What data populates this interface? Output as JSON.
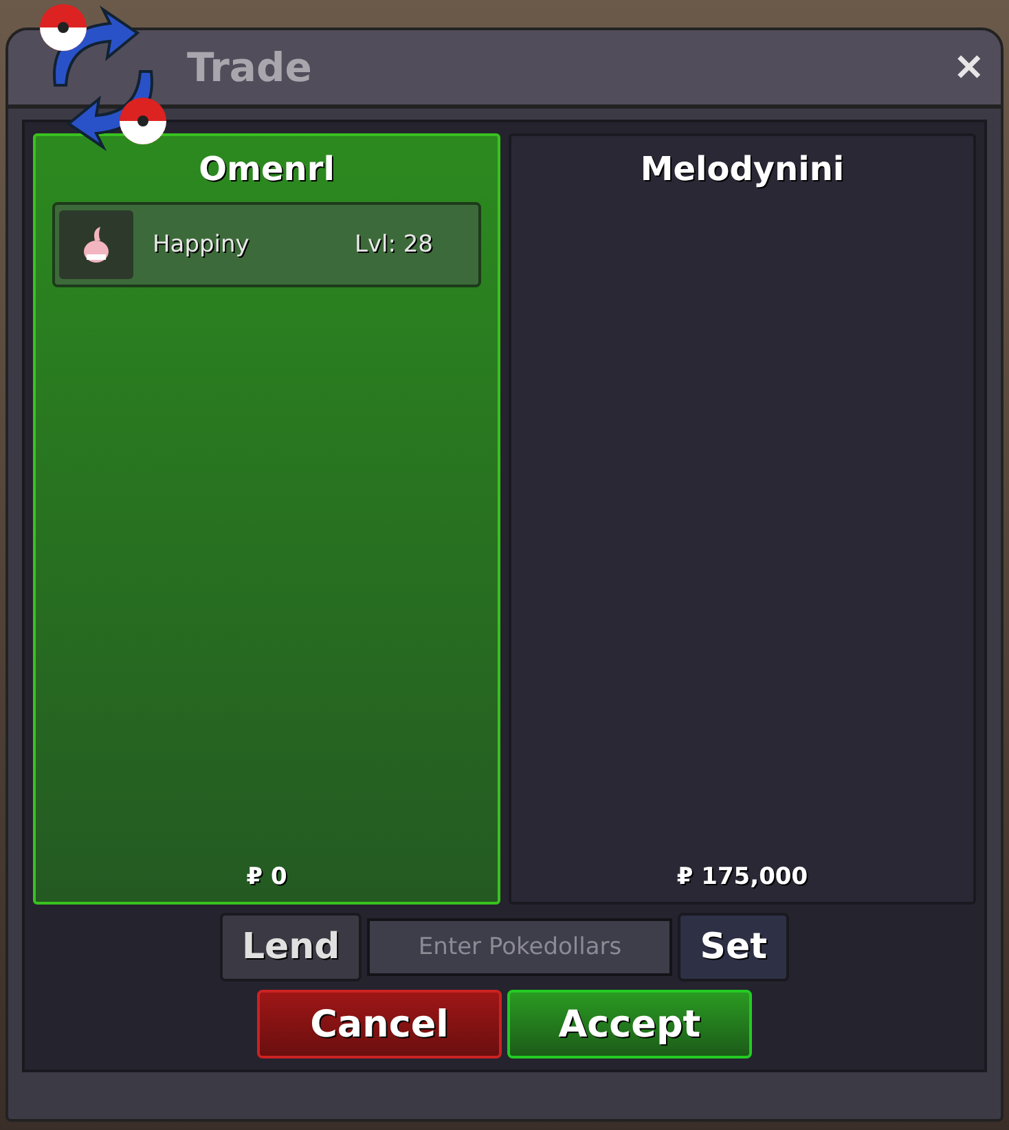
{
  "window": {
    "title": "Trade",
    "close": "✕"
  },
  "panels": [
    {
      "player": "Omenrl",
      "accepted": true,
      "items": [
        {
          "name": "Happiny",
          "level": "Lvl: 28"
        }
      ],
      "money": "₽ 0"
    },
    {
      "player": "Melodynini",
      "accepted": false,
      "money": "₽ 175,000"
    }
  ],
  "money_row": {
    "lend": "Lend",
    "placeholder": "Enter Pokedollars",
    "set": "Set"
  },
  "buttons": [
    {
      "kind": "cancel",
      "label": "Cancel"
    },
    {
      "kind": "accept",
      "label": "Accept"
    }
  ]
}
